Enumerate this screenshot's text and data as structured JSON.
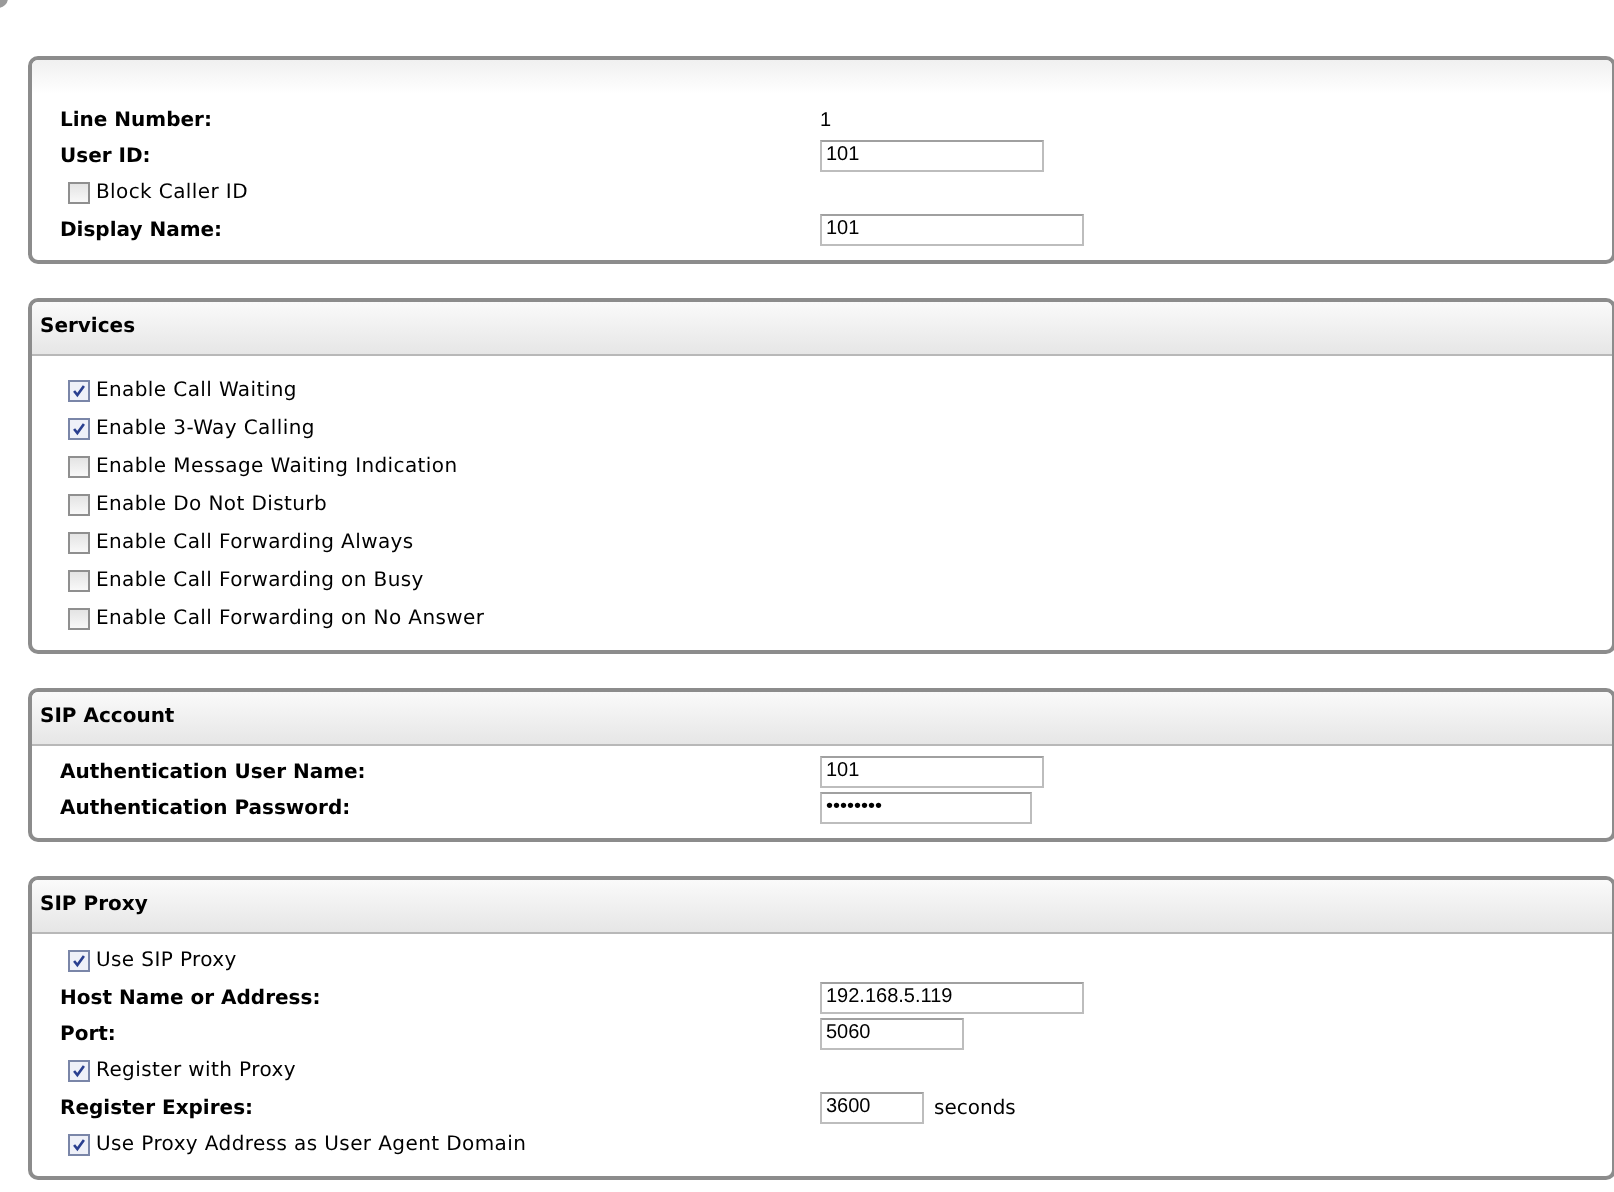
{
  "sections": [
    {
      "rows": [
        {
          "kind": "text",
          "label": "Line Number:",
          "value": "1"
        },
        {
          "kind": "field",
          "label": "User ID:",
          "value": "101"
        },
        {
          "kind": "checkbox",
          "label": "Block Caller ID",
          "checked": false
        },
        {
          "kind": "field",
          "label": "Display Name:",
          "value": "101"
        }
      ]
    },
    {
      "title": "Services",
      "rows": [
        {
          "kind": "checkbox",
          "label": "Enable Call Waiting",
          "checked": true
        },
        {
          "kind": "checkbox",
          "label": "Enable 3-Way Calling",
          "checked": true
        },
        {
          "kind": "checkbox",
          "label": "Enable Message Waiting Indication",
          "checked": false
        },
        {
          "kind": "checkbox",
          "label": "Enable Do Not Disturb",
          "checked": false
        },
        {
          "kind": "checkbox",
          "label": "Enable Call Forwarding Always",
          "checked": false
        },
        {
          "kind": "checkbox",
          "label": "Enable Call Forwarding on Busy",
          "checked": false
        },
        {
          "kind": "checkbox",
          "label": "Enable Call Forwarding on No Answer",
          "checked": false
        }
      ]
    },
    {
      "title": "SIP Account",
      "rows": [
        {
          "kind": "field",
          "label": "Authentication User Name:",
          "value": "101"
        },
        {
          "kind": "field",
          "label": "Authentication Password:",
          "value": "••••••••"
        }
      ]
    },
    {
      "title": "SIP Proxy",
      "rows": [
        {
          "kind": "checkbox",
          "label": "Use SIP Proxy",
          "checked": true
        },
        {
          "kind": "field",
          "label": "Host Name or Address:",
          "value": "192.168.5.119"
        },
        {
          "kind": "field",
          "label": "Port:",
          "value": "5060"
        },
        {
          "kind": "checkbox",
          "label": "Register with Proxy",
          "checked": true
        },
        {
          "kind": "field",
          "label": "Register Expires:",
          "value": "3600",
          "unit": "seconds"
        },
        {
          "kind": "checkbox",
          "label": "Use Proxy Address as User Agent Domain",
          "checked": true
        }
      ]
    }
  ]
}
